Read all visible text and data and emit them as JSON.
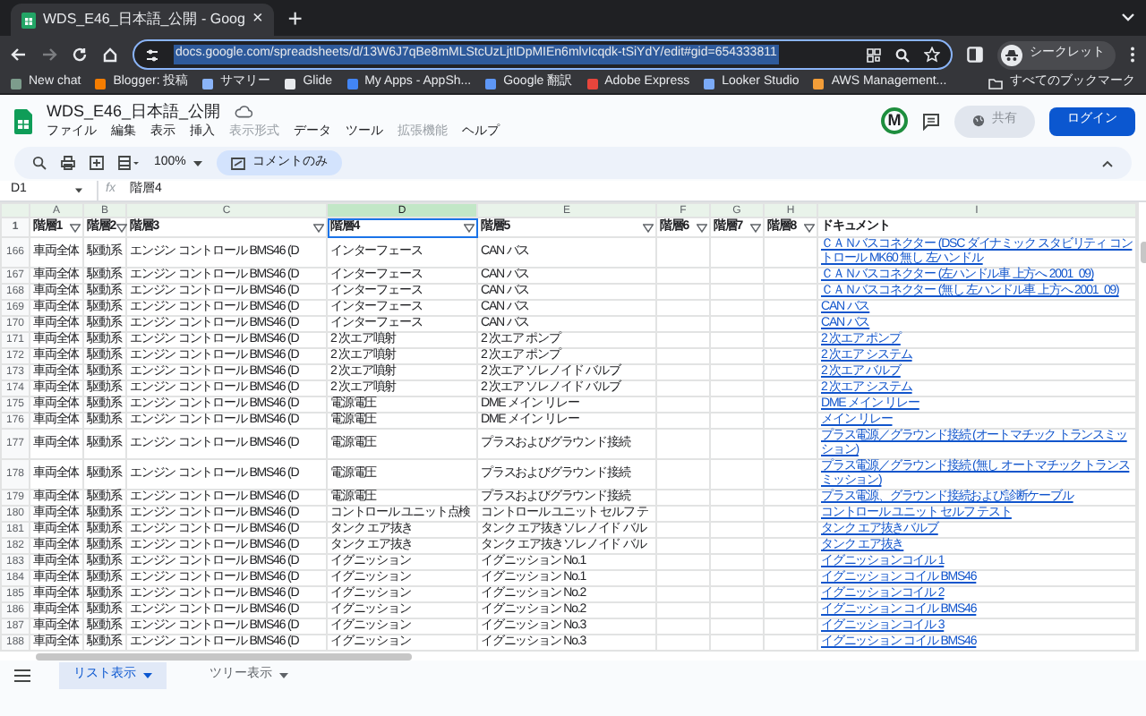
{
  "browser": {
    "tab": {
      "title": "WDS_E46_日本語_公開 - Goog",
      "close": "×"
    },
    "new_tab": "+",
    "forward_disabled": true,
    "url": "docs.google.com/spreadsheets/d/13W6J7qBe8mMLStcUzLjtIDpMIEn6mlvIcqdk-tSiYdY/edit#gid=654333811",
    "profile": "シークレット",
    "bookmarks": [
      {
        "label": "New chat",
        "color": "#7d9c8c"
      },
      {
        "label": "Blogger: 投稿",
        "color": "#f57d00"
      },
      {
        "label": "サマリー",
        "color": "#8ab4f8"
      },
      {
        "label": "Glide",
        "color": "#e8eaed"
      },
      {
        "label": "My Apps - AppSh...",
        "color": "#4285f4"
      },
      {
        "label": "Google 翻訳",
        "color": "#5e97f6"
      },
      {
        "label": "Adobe Express",
        "color": "#e8453c"
      },
      {
        "label": "Looker Studio",
        "color": "#7baaf7"
      },
      {
        "label": "AWS Management...",
        "color": "#f29d38"
      }
    ],
    "all_bookmarks": "すべてのブックマーク"
  },
  "sheet": {
    "title": "WDS_E46_日本語_公開",
    "menus": [
      {
        "label": "ファイル",
        "disabled": false
      },
      {
        "label": "編集",
        "disabled": false
      },
      {
        "label": "表示",
        "disabled": false
      },
      {
        "label": "挿入",
        "disabled": false
      },
      {
        "label": "表示形式",
        "disabled": true
      },
      {
        "label": "データ",
        "disabled": false
      },
      {
        "label": "ツール",
        "disabled": false
      },
      {
        "label": "拡張機能",
        "disabled": true
      },
      {
        "label": "ヘルプ",
        "disabled": false
      }
    ],
    "avatar": "M",
    "share": {
      "label": "共有",
      "disabled": true
    },
    "login": "ログイン",
    "zoom": "100%",
    "mode": "コメントのみ",
    "name_box": "D1",
    "formula_icon": "fx",
    "formula": "階層4"
  },
  "columns": [
    {
      "letter": "A",
      "header": "階層1",
      "kind": "text",
      "filter": true,
      "selected": false
    },
    {
      "letter": "B",
      "header": "階層2",
      "kind": "text",
      "filter": true,
      "selected": false
    },
    {
      "letter": "C",
      "header": "階層3",
      "kind": "text",
      "filter": true,
      "selected": false
    },
    {
      "letter": "D",
      "header": "階層4",
      "kind": "text",
      "filter": true,
      "selected": true
    },
    {
      "letter": "E",
      "header": "階層5",
      "kind": "text",
      "filter": true,
      "selected": false
    },
    {
      "letter": "F",
      "header": "階層6",
      "kind": "empty",
      "filter": true,
      "selected": false
    },
    {
      "letter": "G",
      "header": "階層7",
      "kind": "empty",
      "filter": true,
      "selected": false
    },
    {
      "letter": "H",
      "header": "階層8",
      "kind": "empty",
      "filter": true,
      "selected": false
    },
    {
      "letter": "I",
      "header": "ドキュメント",
      "kind": "link",
      "filter": false,
      "selected": false
    }
  ],
  "header_row": "1",
  "rows": [
    {
      "number": "166",
      "cells": [
        "車両全体",
        "駆動系",
        "エンジン コントロール BMS46 (D",
        "インターフェース",
        "CAN バス",
        "ＣＡＮバスコネクター (DSC ダイナミック スタビリティ コントロール MK60 無し 左ハンドル"
      ]
    },
    {
      "number": "167",
      "cells": [
        "車両全体",
        "駆動系",
        "エンジン コントロール BMS46 (D",
        "インターフェース",
        "CAN バス",
        "ＣＡＮバスコネクター (左ハンドル車 上方へ 2001_09)"
      ]
    },
    {
      "number": "168",
      "cells": [
        "車両全体",
        "駆動系",
        "エンジン コントロール BMS46 (D",
        "インターフェース",
        "CAN バス",
        "ＣＡＮバスコネクター (無し 左ハンドル車 上方へ 2001_09)"
      ]
    },
    {
      "number": "169",
      "cells": [
        "車両全体",
        "駆動系",
        "エンジン コントロール BMS46 (D",
        "インターフェース",
        "CAN バス",
        "CAN バス"
      ]
    },
    {
      "number": "170",
      "cells": [
        "車両全体",
        "駆動系",
        "エンジン コントロール BMS46 (D",
        "インターフェース",
        "CAN バス",
        "CAN バス"
      ]
    },
    {
      "number": "171",
      "cells": [
        "車両全体",
        "駆動系",
        "エンジン コントロール BMS46 (D",
        "2 次エア噴射",
        "2 次エア ポンプ",
        "2 次エア ポンプ"
      ]
    },
    {
      "number": "172",
      "cells": [
        "車両全体",
        "駆動系",
        "エンジン コントロール BMS46 (D",
        "2 次エア噴射",
        "2 次エア ポンプ",
        "2 次エア システム"
      ]
    },
    {
      "number": "173",
      "cells": [
        "車両全体",
        "駆動系",
        "エンジン コントロール BMS46 (D",
        "2 次エア噴射",
        "2 次エア ソレノイド バルブ",
        "2 次エア バルブ"
      ]
    },
    {
      "number": "174",
      "cells": [
        "車両全体",
        "駆動系",
        "エンジン コントロール BMS46 (D",
        "2 次エア噴射",
        "2 次エア ソレノイド バルブ",
        "2 次エア システム"
      ]
    },
    {
      "number": "175",
      "cells": [
        "車両全体",
        "駆動系",
        "エンジン コントロール BMS46 (D",
        "電源電圧",
        "DME メイン リレー",
        "DME メイン リレー"
      ]
    },
    {
      "number": "176",
      "cells": [
        "車両全体",
        "駆動系",
        "エンジン コントロール BMS46 (D",
        "電源電圧",
        "DME メイン リレー",
        "メイン リレー"
      ]
    },
    {
      "number": "177",
      "cells": [
        "車両全体",
        "駆動系",
        "エンジン コントロール BMS46 (D",
        "電源電圧",
        "プラスおよびグラウンド接続",
        "プラス電源／グラウンド接続 (オートマチック トランスミッション)"
      ]
    },
    {
      "number": "178",
      "cells": [
        "車両全体",
        "駆動系",
        "エンジン コントロール BMS46 (D",
        "電源電圧",
        "プラスおよびグラウンド接続",
        "プラス電源／グラウンド接続 (無し オートマチック トランスミッション)"
      ]
    },
    {
      "number": "179",
      "cells": [
        "車両全体",
        "駆動系",
        "エンジン コントロール BMS46 (D",
        "電源電圧",
        "プラスおよびグラウンド接続",
        "プラス電源、グラウンド接続および診断ケーブル"
      ]
    },
    {
      "number": "180",
      "cells": [
        "車両全体",
        "駆動系",
        "エンジン コントロール BMS46 (D",
        "コントロール ユニット点検",
        "コントロール ユニット セルフ テ",
        "コントロール ユニット セルフ テスト"
      ]
    },
    {
      "number": "181",
      "cells": [
        "車両全体",
        "駆動系",
        "エンジン コントロール BMS46 (D",
        "タンク エア抜き",
        "タンク エア抜きソレノイド バル",
        "タンク エア抜きバルブ"
      ]
    },
    {
      "number": "182",
      "cells": [
        "車両全体",
        "駆動系",
        "エンジン コントロール BMS46 (D",
        "タンク エア抜き",
        "タンク エア抜きソレノイド バル",
        "タンク エア抜き"
      ]
    },
    {
      "number": "183",
      "cells": [
        "車両全体",
        "駆動系",
        "エンジン コントロール BMS46 (D",
        "イグニッション",
        "イグニッション No.1",
        "イグニッションコイル 1"
      ]
    },
    {
      "number": "184",
      "cells": [
        "車両全体",
        "駆動系",
        "エンジン コントロール BMS46 (D",
        "イグニッション",
        "イグニッション No.1",
        "イグニッション コイル BMS46"
      ]
    },
    {
      "number": "185",
      "cells": [
        "車両全体",
        "駆動系",
        "エンジン コントロール BMS46 (D",
        "イグニッション",
        "イグニッション No.2",
        "イグニッションコイル 2"
      ]
    },
    {
      "number": "186",
      "cells": [
        "車両全体",
        "駆動系",
        "エンジン コントロール BMS46 (D",
        "イグニッション",
        "イグニッション No.2",
        "イグニッション コイル BMS46"
      ]
    },
    {
      "number": "187",
      "cells": [
        "車両全体",
        "駆動系",
        "エンジン コントロール BMS46 (D",
        "イグニッション",
        "イグニッション No.3",
        "イグニッションコイル 3"
      ]
    },
    {
      "number": "188",
      "cells": [
        "車両全体",
        "駆動系",
        "エンジン コントロール BMS46 (D",
        "イグニッション",
        "イグニッション No.3",
        "イグニッション コイル BMS46"
      ]
    }
  ],
  "sheet_tabs": [
    {
      "label": "リスト表示",
      "selected": true
    },
    {
      "label": "ツリー表示",
      "selected": false
    }
  ]
}
